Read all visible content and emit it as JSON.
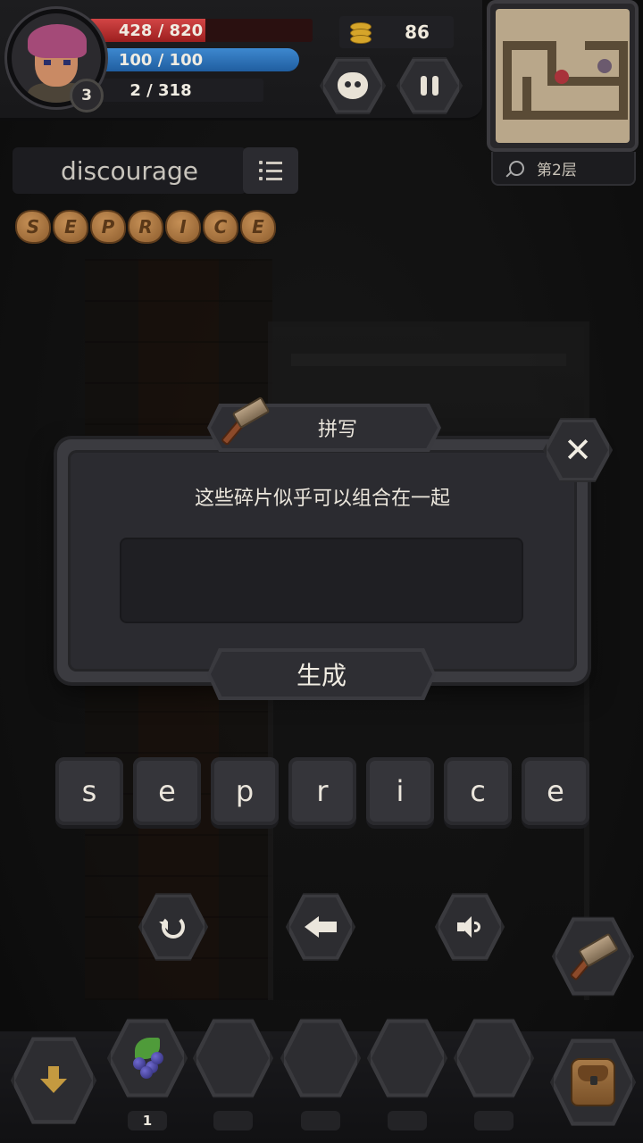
{
  "hud": {
    "hp": {
      "current": 428,
      "max": 820,
      "label": "428 / 820",
      "color": "#c43232"
    },
    "mp": {
      "current": 100,
      "max": 100,
      "label": "100 / 100",
      "color": "#2f74bb"
    },
    "xp": {
      "current": 2,
      "max": 318,
      "label": "2 / 318"
    },
    "level": "3",
    "coins": "86",
    "floor": "第2层"
  },
  "word": {
    "text": "discourage",
    "fragments": [
      "S",
      "E",
      "P",
      "R",
      "I",
      "C",
      "E"
    ]
  },
  "dialog": {
    "title": "拼写",
    "message": "这些碎片似乎可以组合在一起",
    "input_value": "",
    "generate_label": "生成"
  },
  "letters": [
    "s",
    "e",
    "p",
    "r",
    "i",
    "c",
    "e"
  ],
  "inventory": {
    "slots": [
      {
        "item": "berry-icon",
        "count": "1"
      },
      {
        "item": "",
        "count": ""
      },
      {
        "item": "",
        "count": ""
      },
      {
        "item": "",
        "count": ""
      },
      {
        "item": "",
        "count": ""
      }
    ]
  },
  "icons": {
    "pet": "pet-icon",
    "pause": "pause-icon",
    "list": "list-icon",
    "hammer": "hammer-icon",
    "close": "close-icon",
    "reset": "reset-icon",
    "backspace": "arrow-left-icon",
    "sound": "speaker-icon",
    "down": "arrow-down-icon",
    "bag": "backpack-icon",
    "search": "search-icon"
  },
  "colors": {
    "accent": "#c49a40",
    "panel": "#2b2b30",
    "text": "#ece7dd"
  }
}
